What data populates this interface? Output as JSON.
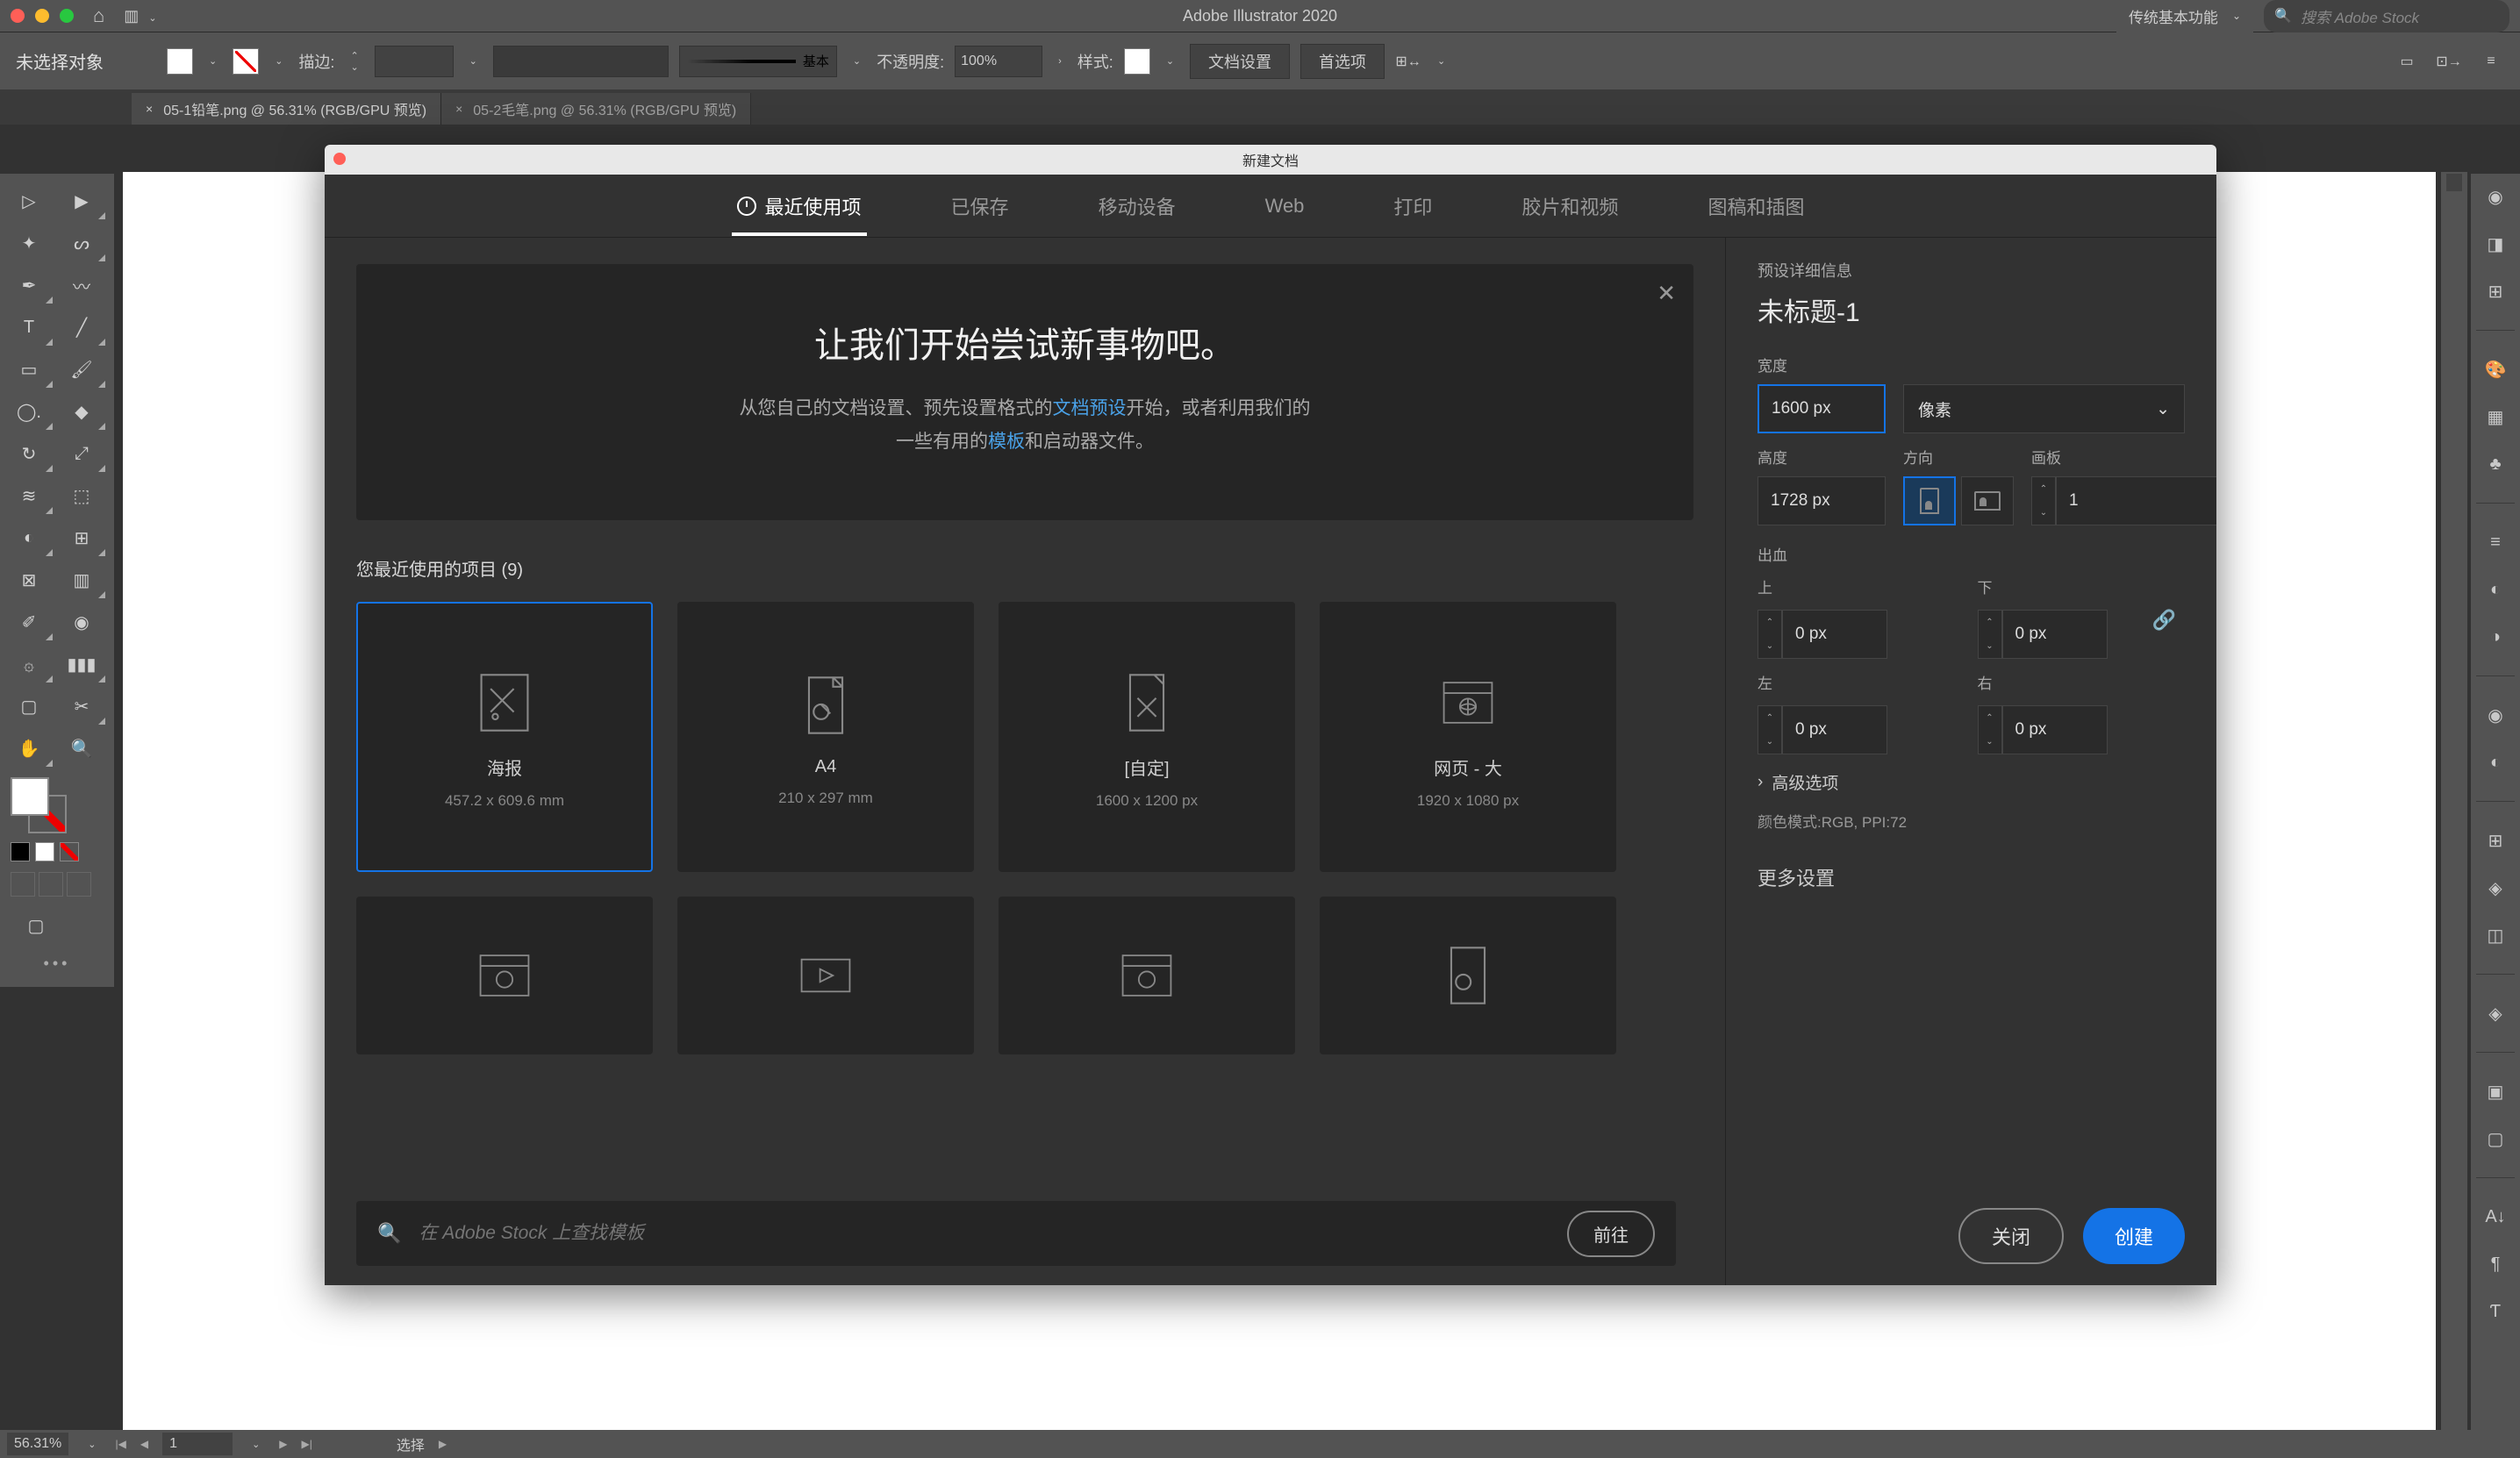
{
  "app": {
    "title": "Adobe Illustrator 2020"
  },
  "topbar": {
    "workspace": "传统基本功能",
    "search_placeholder": "搜索 Adobe Stock"
  },
  "options": {
    "no_selection": "未选择对象",
    "stroke_label": "描边:",
    "stroke_weight": "",
    "stroke_style": "基本",
    "opacity_label": "不透明度:",
    "opacity_value": "100%",
    "style_label": "样式:",
    "doc_setup": "文档设置",
    "prefs": "首选项"
  },
  "tabs": [
    "05-1铅笔.png @ 56.31% (RGB/GPU 预览)",
    "05-2毛笔.png @ 56.31% (RGB/GPU 预览)"
  ],
  "status": {
    "zoom": "56.31%",
    "artboard": "1",
    "selection": "选择"
  },
  "modal": {
    "title": "新建文档",
    "tabs": {
      "recent": "最近使用项",
      "saved": "已保存",
      "mobile": "移动设备",
      "web": "Web",
      "print": "打印",
      "film": "胶片和视频",
      "art": "图稿和插图"
    },
    "hero": {
      "heading": "让我们开始尝试新事物吧。",
      "line1_a": "从您自己的文档设置、预先设置格式的",
      "line1_b": "文档预设",
      "line1_c": "开始，或者利用我们的",
      "line2_a": "一些有用的",
      "line2_b": "模板",
      "line2_c": "和启动器文件。"
    },
    "recent_label": "您最近使用的项目  (9)",
    "presets": [
      {
        "name": "海报",
        "size": "457.2 x 609.6 mm"
      },
      {
        "name": "A4",
        "size": "210 x 297 mm"
      },
      {
        "name": "[自定]",
        "size": "1600 x 1200 px"
      },
      {
        "name": "网页 - 大",
        "size": "1920 x 1080 px"
      }
    ],
    "stock_placeholder": "在 Adobe Stock 上查找模板",
    "go_btn": "前往",
    "detail": {
      "header": "预设详细信息",
      "name": "未标题-1",
      "width_label": "宽度",
      "width": "1600 px",
      "unit": "像素",
      "height_label": "高度",
      "height": "1728 px",
      "orient_label": "方向",
      "artboard_label": "画板",
      "artboards": "1",
      "bleed_label": "出血",
      "top": "上",
      "bottom": "下",
      "left": "左",
      "right": "右",
      "bleed_val": "0 px",
      "advanced": "高级选项",
      "color_mode": "颜色模式:RGB, PPI:72",
      "more": "更多设置"
    },
    "close_btn": "关闭",
    "create_btn": "创建"
  }
}
